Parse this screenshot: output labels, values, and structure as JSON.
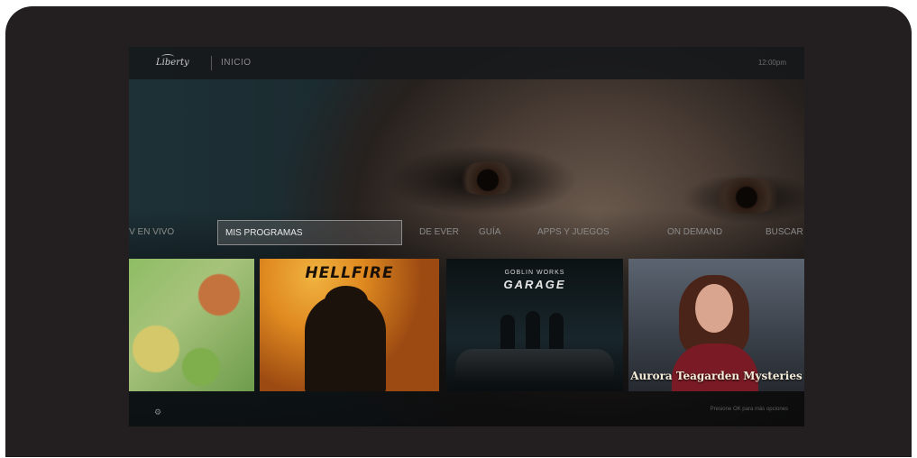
{
  "topbar": {
    "logo_text": "Liberty",
    "title": "INICIO",
    "clock": "12:00pm"
  },
  "nav": {
    "items": [
      {
        "label": "TV EN VIVO"
      },
      {
        "label": "MIS PROGRAMAS"
      },
      {
        "label": "DE EVER"
      },
      {
        "label": "GUÍA"
      },
      {
        "label": "APPS Y JUEGOS"
      },
      {
        "label": "ON DEMAND"
      },
      {
        "label": "BUSCAR"
      }
    ],
    "selected_index": 1
  },
  "tiles": [
    {
      "title": "",
      "icon": "cartoon-village"
    },
    {
      "title": "HELLFIRE",
      "icon": "firefighter"
    },
    {
      "subtitle": "GOBLIN WORKS",
      "title": "GARAGE",
      "icon": "mechanics"
    },
    {
      "title": "Aurora Teagarden Mysteries",
      "icon": "woman-portrait"
    }
  ],
  "footer": {
    "icon": "settings-icon",
    "icon_glyph": "⚙",
    "hint": "Presione OK para más opciones"
  },
  "colors": {
    "frame": "#231f20",
    "selected_border": "#8c8c8c",
    "nav_text": "#8b8b8b"
  }
}
